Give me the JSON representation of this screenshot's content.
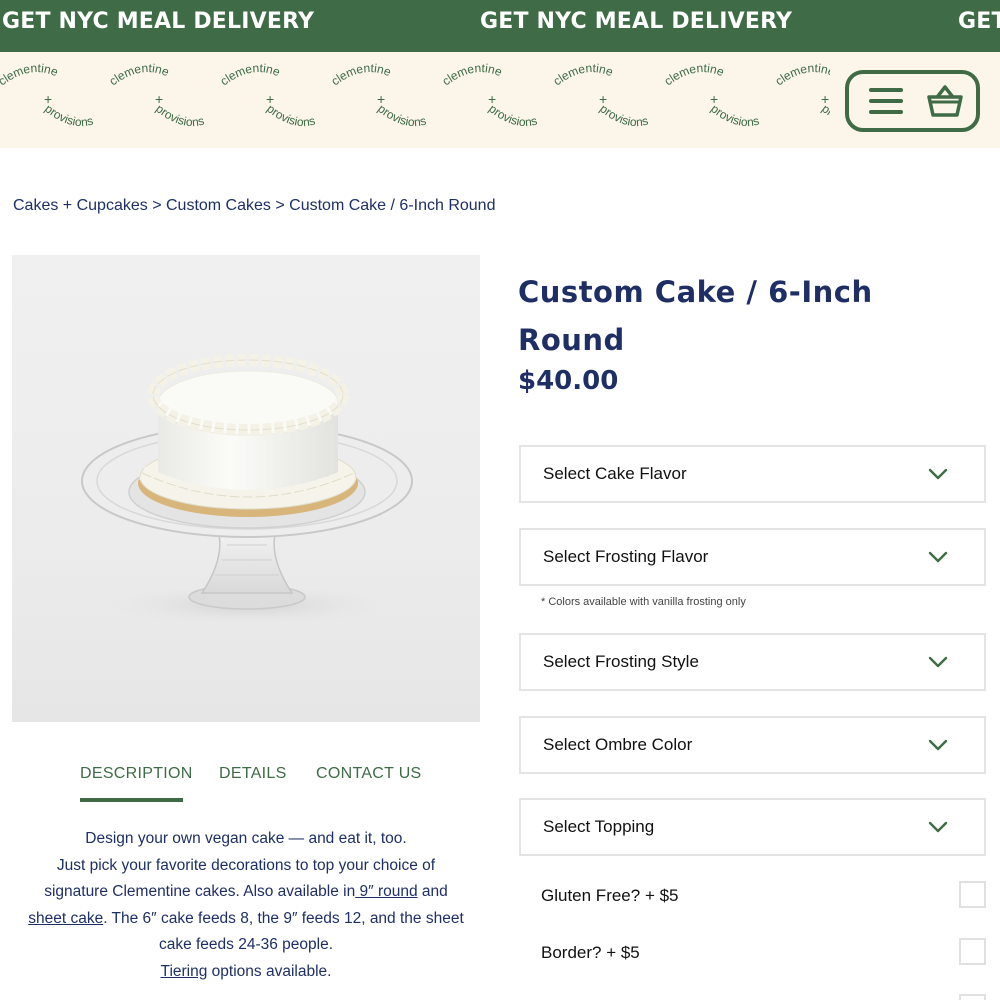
{
  "banner": {
    "text": "GET NYC MEAL DELIVERY",
    "background": "#3f6b46"
  },
  "header": {
    "logo_word_top": "clementine",
    "logo_word_plus": "+",
    "logo_word_bottom": "provisions",
    "menu_icon": "hamburger-menu-icon",
    "cart_icon": "basket-icon"
  },
  "breadcrumb": {
    "items": [
      "Cakes + Cupcakes",
      "Custom Cakes",
      "Custom Cake / 6-Inch Round"
    ],
    "separator": ">"
  },
  "product": {
    "title": "Custom Cake / 6-Inch Round",
    "price": "$40.00",
    "image": "white frosted cake on glass cake stand"
  },
  "tabs": {
    "items": [
      "DESCRIPTION",
      "DETAILS",
      "CONTACT US"
    ],
    "active": "DESCRIPTION"
  },
  "description": {
    "line1": "Design your own vegan cake — and eat it, too.",
    "line2": "Just pick your favorite decorations to top your choice of",
    "line3_pre": "signature Clementine cakes. Also available in",
    "line3_link": " 9″ round",
    "line3_post": " and",
    "line4_link": "sheet cake",
    "line4_post": ". The 6″ cake feeds 8, the 9″ feeds 12, and the sheet",
    "line5": "cake feeds 24-36 people.",
    "line6_link": "Tiering",
    "line6_post": " options available."
  },
  "selects": {
    "cake_flavor": "Select Cake Flavor",
    "frosting_flavor": "Select Frosting Flavor",
    "frosting_note": "* Colors available with vanilla frosting only",
    "frosting_style": "Select Frosting Style",
    "ombre_color": "Select Ombre Color",
    "topping": "Select Topping"
  },
  "options": {
    "gluten_free": "Gluten Free? + $5",
    "border": "Border? + $5"
  },
  "colors": {
    "brand_green": "#3f6b46",
    "navy": "#1f2f66",
    "cream": "#fbf5ea"
  }
}
